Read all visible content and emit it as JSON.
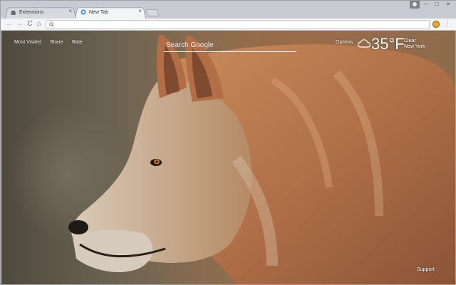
{
  "tabs": [
    {
      "label": "Extensions",
      "close": "×",
      "icon": "puzzle-icon"
    },
    {
      "label": "New Tab",
      "close": "×",
      "icon": "chrome-icon"
    }
  ],
  "window_controls": {
    "minimize": "–",
    "maximize": "□",
    "close": "×"
  },
  "toolbar": {
    "back": "←",
    "forward": "→",
    "reload": "C",
    "home": "⌂",
    "menu": "⋮",
    "omnibox_value": ""
  },
  "page": {
    "top_links": {
      "most_visited": "Most Visited",
      "share": "Share",
      "rate": "Rate"
    },
    "search_placeholder": "Search Google",
    "options": "Options",
    "weather": {
      "temperature": "35°F",
      "condition": "Clear",
      "location": "New York",
      "icon": "cloud-icon"
    },
    "support": "Support"
  },
  "colors": {
    "tab_active": "#f3f4f5",
    "tab_inactive": "#d6d9de",
    "toolbar": "#f3f4f5"
  }
}
